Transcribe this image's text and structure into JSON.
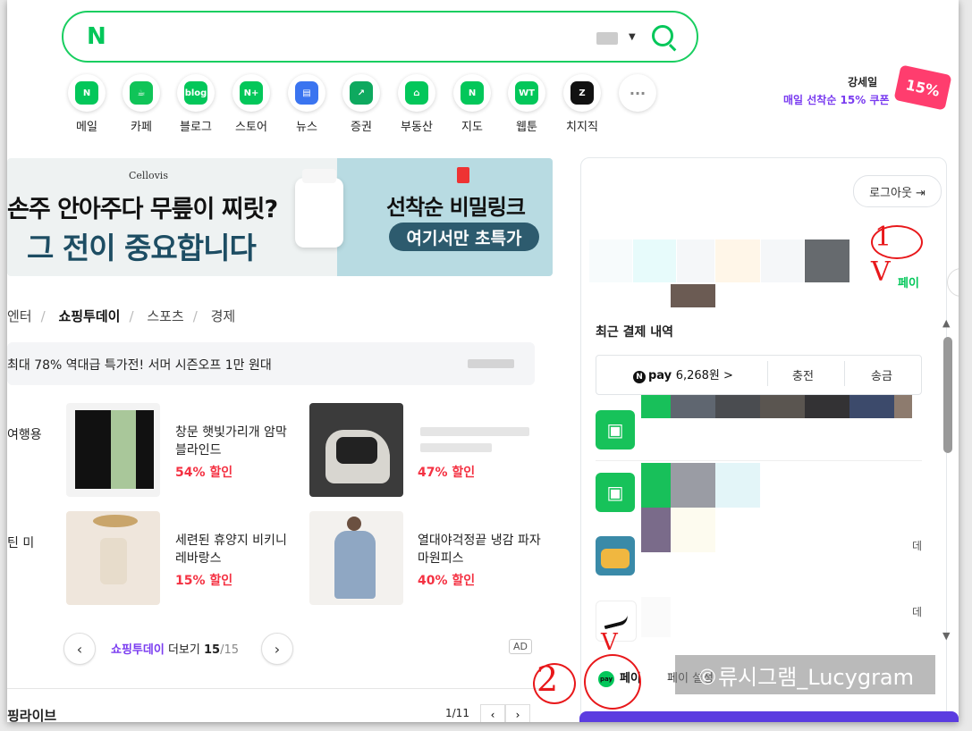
{
  "search": {
    "logo": "N",
    "keyboard_icon": "keyboard-icon",
    "search_icon": "search-icon"
  },
  "shortcuts": [
    {
      "label": "메일",
      "icon": "mail-icon",
      "glyph": "N",
      "color": "#03c75a"
    },
    {
      "label": "카페",
      "icon": "cafe-icon",
      "glyph": "☕",
      "color": "#10c458"
    },
    {
      "label": "블로그",
      "icon": "blog-icon",
      "glyph": "blog",
      "color": "#03c75a"
    },
    {
      "label": "스토어",
      "icon": "store-icon",
      "glyph": "N+",
      "color": "#03c75a"
    },
    {
      "label": "뉴스",
      "icon": "news-icon",
      "glyph": "▤",
      "color": "#3a74f0"
    },
    {
      "label": "증권",
      "icon": "stock-icon",
      "glyph": "↗",
      "color": "#0ea95f"
    },
    {
      "label": "부동산",
      "icon": "realestate-icon",
      "glyph": "⌂",
      "color": "#03c75a"
    },
    {
      "label": "지도",
      "icon": "map-icon",
      "glyph": "N",
      "color": "#03c75a"
    },
    {
      "label": "웹툰",
      "icon": "webtoon-icon",
      "glyph": "WT",
      "color": "#03c75a"
    },
    {
      "label": "치지직",
      "icon": "chzzk-icon",
      "glyph": "Z",
      "color": "#111111"
    },
    {
      "label": "",
      "icon": "more-icon",
      "glyph": "···",
      "color": "#ffffff"
    }
  ],
  "promo": {
    "name": "강세일",
    "text": "매일 선착순 15% 쿠폰",
    "badge": "15%"
  },
  "banner": {
    "brand": "Cellovis",
    "headline1": "손주 안아주다 무릎이 찌릿?",
    "headline2": "그 전이 중요합니다",
    "title_right": "선착순 비밀링크",
    "pill": "여기서만 초특가"
  },
  "tabs": [
    "엔터",
    "쇼핑투데이",
    "스포츠",
    "경제"
  ],
  "notice": "최대 78% 역대급 특가전! 서머 시즌오프 1만 원대",
  "products": [
    {
      "name": "창문 햇빛가리개 암막 블라인드",
      "discount": "54% 할인"
    },
    {
      "name": "",
      "discount": "47% 할인"
    },
    {
      "name": "세련된 휴양지 비키니 레바랑스",
      "discount": "15% 할인"
    },
    {
      "name": "열대야걱정끝 냉감 파자마원피스",
      "discount": "40% 할인"
    }
  ],
  "edge_text": [
    "여행용",
    "틴 미"
  ],
  "pagination": {
    "more_brand": "쇼핑투데이",
    "more_text": "더보기",
    "current": "15",
    "total": "/15",
    "ad": "AD"
  },
  "bottom": {
    "title": "핑라이브",
    "pager": "1/11"
  },
  "account": {
    "logout": "로그아웃 ⇥",
    "pay_tab": "페이"
  },
  "payments": {
    "title": "최근 결제 내역",
    "npay_label": "pay",
    "balance": "6,268원 >",
    "charge": "충전",
    "send": "송금",
    "trail": [
      "데",
      "데",
      "데"
    ]
  },
  "footer": {
    "pay": "페이",
    "settle": "페이 설정",
    "pay_logo": "pay"
  },
  "watermark": "©류시그램_Lucygram",
  "annotations": {
    "one": "1",
    "two": "2",
    "check": "V"
  }
}
